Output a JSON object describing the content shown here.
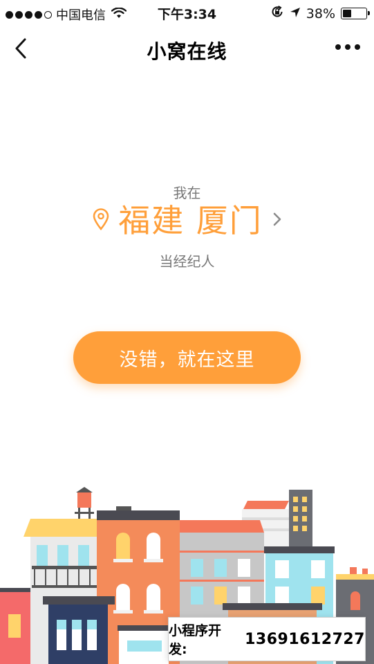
{
  "status_bar": {
    "carrier": "中国电信",
    "time": "下午3:34",
    "battery_percent": "38%",
    "battery_level": 0.38,
    "signal_bars_filled": 4,
    "signal_bars_total": 5,
    "icons": [
      "signal-dots-icon",
      "wifi-icon",
      "rotation-lock-icon",
      "location-arrow-icon",
      "battery-icon"
    ]
  },
  "nav": {
    "title": "小窝在线",
    "back_icon": "chevron-left-icon",
    "more_icon": "more-dots-icon"
  },
  "location": {
    "prefix": "我在",
    "city": "福建 厦门",
    "suffix": "当经纪人",
    "pin_icon": "map-pin-icon",
    "arrow_icon": "chevron-right-icon"
  },
  "confirm_button": {
    "label": "没错，就在这里"
  },
  "ad": {
    "label": "小程序开发:",
    "phone": "13691612727"
  },
  "colors": {
    "accent": "#FF9F3A",
    "muted_text": "#777777"
  }
}
